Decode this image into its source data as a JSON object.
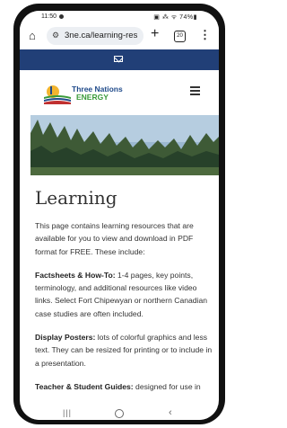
{
  "status": {
    "time": "11:50",
    "right": "▣ ⁂ ᯤ 74%▮"
  },
  "browser": {
    "url": "3ne.ca/learning-res",
    "tab_count": "20"
  },
  "site": {
    "brand_line1": "Three Nations",
    "brand_line2": "ENERGY"
  },
  "main": {
    "title": "Learning",
    "intro": "This page contains learning resources that are available for you to view and download in PDF format for FREE. These include:",
    "items": [
      {
        "label": "Factsheets & How-To:",
        "text": " 1-4 pages, key points, terminology, and additional resources like video links. Select Fort Chipewyan or northern Canadian case studies are often included."
      },
      {
        "label": "Display Posters:",
        "text": " lots of colorful graphics and less text. They can be resized for printing or to include in a presentation."
      },
      {
        "label": "Teacher & Student Guides:",
        "text": " designed for use in"
      }
    ]
  },
  "colors": {
    "nav_strip": "#213f77",
    "brand_blue": "#1f4a8a",
    "brand_green": "#3a9a3a"
  }
}
